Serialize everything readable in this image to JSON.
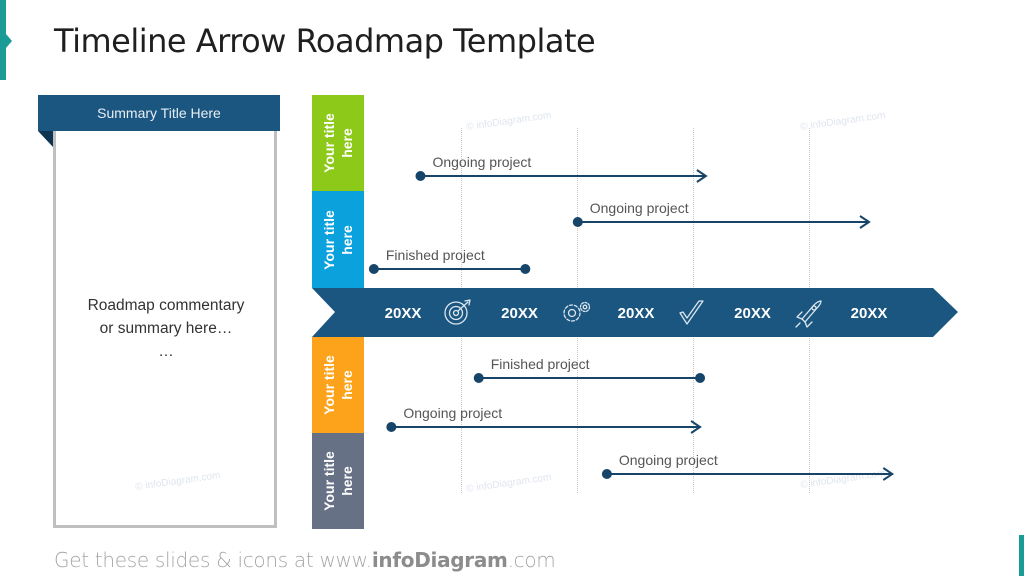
{
  "title": "Timeline Arrow Roadmap Template",
  "summary": {
    "header": "Summary Title Here",
    "line1": "Roadmap commentary",
    "line2": "or summary here…",
    "line3": "…"
  },
  "rows": [
    {
      "label": "Your title\nhere",
      "color": "#8cc919"
    },
    {
      "label": "Your title\nhere",
      "color": "#0aa1dc"
    },
    {
      "label": "Your title\nhere",
      "color": "#fca31b"
    },
    {
      "label": "Your title\nhere",
      "color": "#677186"
    }
  ],
  "timeline": {
    "color": "#1b5680",
    "periods": [
      "20XX",
      "20XX",
      "20XX",
      "20XX",
      "20XX"
    ],
    "icons": [
      "target-icon",
      "gears-icon",
      "checkmark-icon",
      "rocket-icon"
    ]
  },
  "projects": [
    {
      "label": "Ongoing project",
      "status": "ongoing",
      "start": 0.15,
      "end": 2.6
    },
    {
      "label": "Ongoing project",
      "status": "ongoing",
      "start": 1.5,
      "end": 4.0
    },
    {
      "label": "Finished project",
      "status": "finished",
      "start": -0.25,
      "end": 1.05
    },
    {
      "label": "Finished project",
      "status": "finished",
      "start": 0.65,
      "end": 2.55
    },
    {
      "label": "Ongoing project",
      "status": "ongoing",
      "start": -0.1,
      "end": 2.55
    },
    {
      "label": "Ongoing project",
      "status": "ongoing",
      "start": 1.75,
      "end": 4.2
    }
  ],
  "watermark": "© infoDiagram.com",
  "footer": {
    "prefix": "Get these slides & icons at www.",
    "brand": "infoDiagram",
    "suffix": ".com"
  },
  "colors": {
    "accent": "#1a9b95",
    "dark_blue": "#1b5680",
    "line": "#17456a"
  }
}
